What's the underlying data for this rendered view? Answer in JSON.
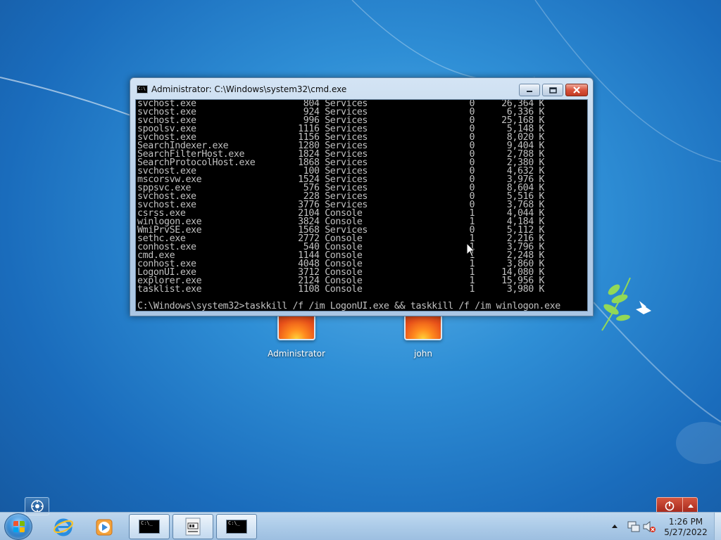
{
  "window": {
    "title": "Administrator: C:\\Windows\\system32\\cmd.exe"
  },
  "console_lines": [
    "svchost.exe                    804 Services                   0     26,364 K",
    "svchost.exe                    924 Services                   0      6,336 K",
    "svchost.exe                    996 Services                   0     25,168 K",
    "spoolsv.exe                   1116 Services                   0      5,148 K",
    "svchost.exe                   1156 Services                   0      8,020 K",
    "SearchIndexer.exe             1280 Services                   0      9,404 K",
    "SearchFilterHost.exe          1824 Services                   0      2,788 K",
    "SearchProtocolHost.exe        1868 Services                   0      2,380 K",
    "svchost.exe                    100 Services                   0      4,632 K",
    "mscorsvw.exe                  1524 Services                   0      3,976 K",
    "sppsvc.exe                     576 Services                   0      8,604 K",
    "svchost.exe                    228 Services                   0      5,516 K",
    "svchost.exe                   3776 Services                   0      3,768 K",
    "csrss.exe                     2104 Console                    1      4,044 K",
    "winlogon.exe                  3824 Console                    1      4,184 K",
    "WmiPrvSE.exe                  1568 Services                   0      5,112 K",
    "sethc.exe                     2772 Console                    1      2,216 K",
    "conhost.exe                    540 Console                    1      3,796 K",
    "cmd.exe                       1144 Console                    1      2,248 K",
    "conhost.exe                   4048 Console                    1      3,860 K",
    "LogonUI.exe                   3712 Console                    1     14,080 K",
    "explorer.exe                  2124 Console                    1     15,956 K",
    "tasklist.exe                  1108 Console                    1      3,980 K",
    "",
    "C:\\Windows\\system32>taskkill /f /im LogonUI.exe && taskkill /f /im winlogon.exe"
  ],
  "desktop": {
    "users": [
      {
        "name": "Administrator"
      },
      {
        "name": "john"
      }
    ]
  },
  "taskbar": {
    "time": "1:26 PM",
    "date": "5/27/2022",
    "cmd_icon_text": "C:\\_"
  },
  "icons": {
    "start": "windows-start-orb",
    "ie": "internet-explorer-icon",
    "media": "windows-media-player-icon",
    "accessibility": "ease-of-access-icon",
    "power": "power-icon"
  },
  "colors": {
    "console_bg": "#000000",
    "console_fg": "#c0c0c0",
    "desktop": "#2f8fd6"
  }
}
